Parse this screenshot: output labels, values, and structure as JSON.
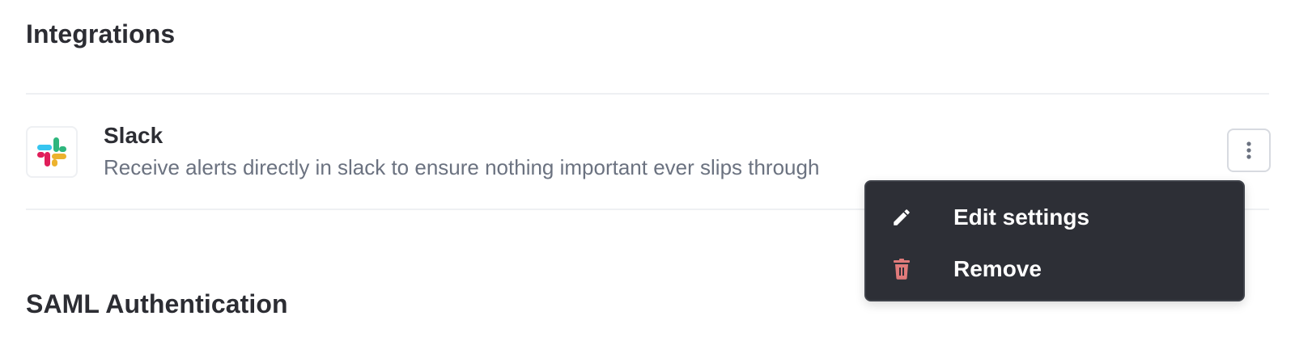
{
  "sections": {
    "integrations_title": "Integrations",
    "saml_title": "SAML Authentication"
  },
  "integration": {
    "name": "Slack",
    "description": "Receive alerts directly in slack to ensure nothing important ever slips through",
    "logo_icon": "slack-logo-icon"
  },
  "more_button": {
    "icon": "more-vertical-icon"
  },
  "menu": {
    "items": [
      {
        "label": "Edit settings",
        "icon": "pencil-icon",
        "icon_color": "#ffffff"
      },
      {
        "label": "Remove",
        "icon": "trash-icon",
        "icon_color": "#e07a7a"
      }
    ]
  },
  "colors": {
    "menu_background": "#2d2f36",
    "description_text": "#6b7280",
    "slack_blue": "#36c5f0",
    "slack_green": "#2eb67d",
    "slack_yellow": "#ecb22e",
    "slack_red": "#e01e5a"
  }
}
